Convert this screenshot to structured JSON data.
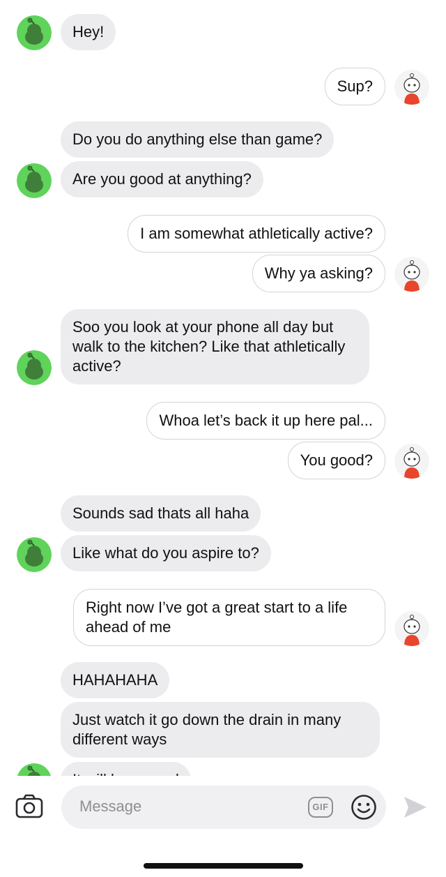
{
  "messages": [
    {
      "text": "Hey!"
    },
    {
      "text": "Sup?"
    },
    {
      "text": "Do you do anything else than game?"
    },
    {
      "text": "Are you good at anything?"
    },
    {
      "text": "I am somewhat athletically active?"
    },
    {
      "text": "Why ya asking?"
    },
    {
      "text": "Soo you look at your phone all day but walk to the kitchen? Like that athletically active?"
    },
    {
      "text": "Whoa let’s back it up here pal..."
    },
    {
      "text": "You good?"
    },
    {
      "text": "Sounds sad thats all haha"
    },
    {
      "text": "Like what do you aspire to?"
    },
    {
      "text": "Right now I’ve got a great start to a life ahead of me"
    },
    {
      "text": "HAHAHAHA"
    },
    {
      "text": "Just watch it go down the drain in many different ways"
    },
    {
      "text": "It will be a good"
    }
  ],
  "composer": {
    "placeholder": "Message",
    "gif_label": "GIF"
  },
  "icons": {
    "camera": "camera-icon",
    "emoji": "emoji-icon",
    "send": "send-icon",
    "incoming_avatar": "green-snoo-avatar",
    "outgoing_avatar": "snoo-red-shirt-avatar"
  },
  "colors": {
    "incoming_bubble": "#ececee",
    "outgoing_border": "#d4d4d8",
    "incoming_avatar_bg": "#5fd35a",
    "outgoing_shirt": "#e8452c",
    "placeholder": "#8e8e93"
  }
}
